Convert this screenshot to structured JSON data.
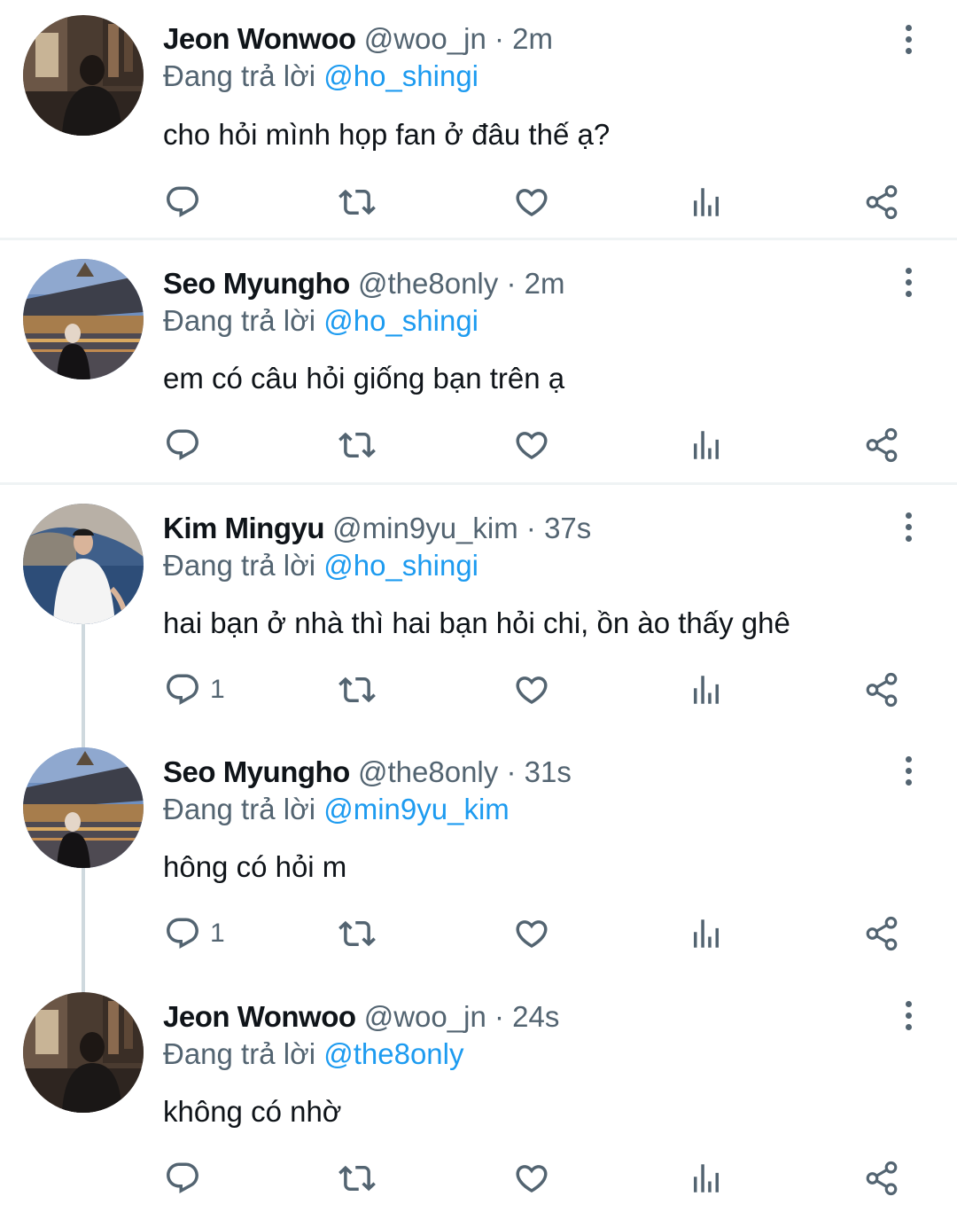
{
  "reply_prefix": "Đang trả lời",
  "tweets": [
    {
      "name": "Jeon Wonwoo",
      "handle": "@woo_jn",
      "sep": "·",
      "time": "2m",
      "reply_to": "@ho_shingi",
      "text": "cho hỏi mình họp fan ở đâu thế ạ?",
      "reply_count": ""
    },
    {
      "name": "Seo Myungho",
      "handle": "@the8only",
      "sep": "·",
      "time": "2m",
      "reply_to": "@ho_shingi",
      "text": "em có câu hỏi giống bạn trên ạ",
      "reply_count": ""
    },
    {
      "name": "Kim Mingyu",
      "handle": "@min9yu_kim",
      "sep": "·",
      "time": "37s",
      "reply_to": "@ho_shingi",
      "text": "hai bạn ở nhà thì hai bạn hỏi chi, ồn ào thấy ghê",
      "reply_count": "1"
    },
    {
      "name": "Seo Myungho",
      "handle": "@the8only",
      "sep": "·",
      "time": "31s",
      "reply_to": "@min9yu_kim",
      "text": "hông có hỏi m",
      "reply_count": "1"
    },
    {
      "name": "Jeon Wonwoo",
      "handle": "@woo_jn",
      "sep": "·",
      "time": "24s",
      "reply_to": "@the8only",
      "text": "không có nhờ",
      "reply_count": ""
    }
  ],
  "colors": {
    "accent": "#1d9bf0",
    "secondary_text": "#536471",
    "primary_text": "#0f1419",
    "thread_line": "#cfd9de"
  },
  "icons": [
    "reply-icon",
    "retweet-icon",
    "like-icon",
    "analytics-icon",
    "share-icon",
    "more-options-icon"
  ]
}
